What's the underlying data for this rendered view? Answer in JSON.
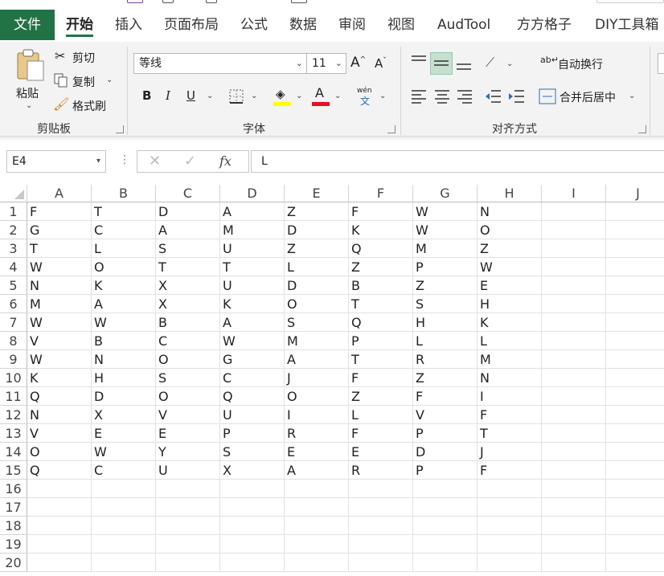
{
  "tabs": {
    "file": "文件",
    "items": [
      "开始",
      "插入",
      "页面布局",
      "公式",
      "数据",
      "审阅",
      "视图",
      "AudTool",
      "方方格子",
      "DIY工具箱"
    ]
  },
  "ribbon": {
    "clipboard": {
      "paste": "粘贴",
      "cut": "剪切",
      "copy": "复制",
      "format_painter": "格式刷",
      "label": "剪贴板"
    },
    "font": {
      "name": "等线",
      "size": "11",
      "bold": "B",
      "italic": "I",
      "underline": "U",
      "font_color_glyph": "A",
      "phonetic_top": "wén",
      "phonetic_bottom": "文",
      "label": "字体",
      "highlight_color": "#FFFF00",
      "font_color": "#E81123"
    },
    "alignment": {
      "wrap_text": "自动换行",
      "merge_center": "合并后居中",
      "label": "对齐方式"
    }
  },
  "formula_bar": {
    "name_box": "E4",
    "fx": "fx",
    "content": "L"
  },
  "sheet": {
    "columns": [
      "A",
      "B",
      "C",
      "D",
      "E",
      "F",
      "G",
      "H",
      "I",
      "J"
    ],
    "rows": [
      "1",
      "2",
      "3",
      "4",
      "5",
      "6",
      "7",
      "8",
      "9",
      "10",
      "11",
      "12",
      "13",
      "14",
      "15",
      "16",
      "17",
      "18",
      "19",
      "20"
    ],
    "cells": [
      [
        "F",
        "T",
        "D",
        "A",
        "Z",
        "F",
        "W",
        "N"
      ],
      [
        "G",
        "C",
        "A",
        "M",
        "D",
        "K",
        "W",
        "O"
      ],
      [
        "T",
        "L",
        "S",
        "U",
        "Z",
        "Q",
        "M",
        "Z"
      ],
      [
        "W",
        "O",
        "T",
        "T",
        "L",
        "Z",
        "P",
        "W"
      ],
      [
        "N",
        "K",
        "X",
        "U",
        "D",
        "B",
        "Z",
        "E"
      ],
      [
        "M",
        "A",
        "X",
        "K",
        "O",
        "T",
        "S",
        "H"
      ],
      [
        "W",
        "W",
        "B",
        "A",
        "S",
        "Q",
        "H",
        "K"
      ],
      [
        "V",
        "B",
        "C",
        "W",
        "M",
        "P",
        "L",
        "L"
      ],
      [
        "W",
        "N",
        "O",
        "G",
        "A",
        "T",
        "R",
        "M"
      ],
      [
        "K",
        "H",
        "S",
        "C",
        "J",
        "F",
        "Z",
        "N"
      ],
      [
        "Q",
        "D",
        "O",
        "Q",
        "O",
        "Z",
        "F",
        "I"
      ],
      [
        "N",
        "X",
        "V",
        "U",
        "I",
        "L",
        "V",
        "F"
      ],
      [
        "V",
        "E",
        "E",
        "P",
        "R",
        "F",
        "P",
        "T"
      ],
      [
        "O",
        "W",
        "Y",
        "S",
        "E",
        "E",
        "D",
        "J"
      ],
      [
        "Q",
        "C",
        "U",
        "X",
        "A",
        "R",
        "P",
        "F"
      ]
    ]
  },
  "colors": {
    "accent": "#217346",
    "selected_align_bg": "#c5e0d0"
  }
}
